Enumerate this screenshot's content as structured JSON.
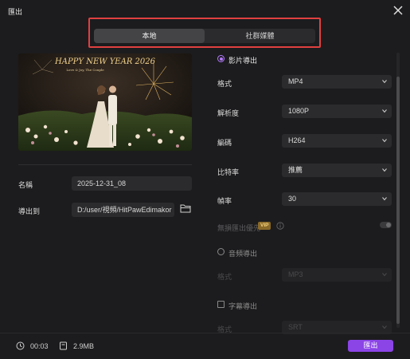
{
  "window": {
    "title": "匯出"
  },
  "tabs": [
    {
      "label": "本地",
      "active": true
    },
    {
      "label": "社群媒體",
      "active": false
    }
  ],
  "preview": {
    "overlay_title": "HAPPY NEW YEAR 2026",
    "overlay_subtitle": "Love & Joy, The Couple"
  },
  "left": {
    "name_label": "名稱",
    "name_value": "2025-12-31_08",
    "export_to_label": "導出到",
    "export_path": "D:/user/視頻/HitPawEdimakor"
  },
  "video_export": {
    "title": "影片導出",
    "selected": true,
    "rows": [
      {
        "label": "格式",
        "value": "MP4"
      },
      {
        "label": "解析度",
        "value": "1080P"
      },
      {
        "label": "編碼",
        "value": "H264"
      },
      {
        "label": "比特率",
        "value": "推薦"
      },
      {
        "label": "幀率",
        "value": "30"
      }
    ],
    "lossless_label": "無損匯出優先",
    "vip_badge": "VIP"
  },
  "audio_export": {
    "title": "音頻導出",
    "row_label": "格式",
    "row_value": "MP3"
  },
  "subtitle_export": {
    "title": "字幕導出",
    "row_label": "格式",
    "row_value": "SRT"
  },
  "footer": {
    "duration": "00:03",
    "size": "2.9MB",
    "export_label": "匯出"
  },
  "colors": {
    "accent": "#8b44e6",
    "highlight": "#e0403f",
    "background": "#1c1c1e"
  }
}
